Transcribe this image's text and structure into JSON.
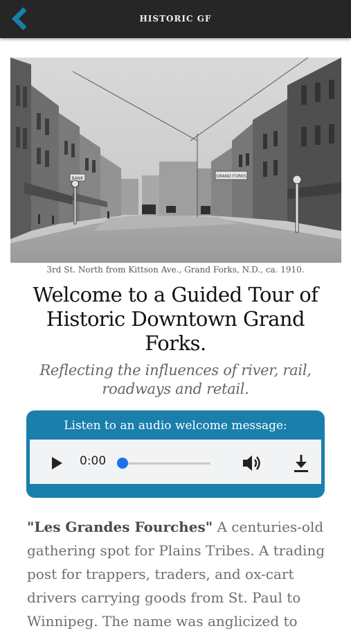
{
  "topbar": {
    "title": "HISTORIC GF",
    "back_icon": "back-chevron-icon",
    "accent": "#1a7fab"
  },
  "photo": {
    "sign_left": "BANK",
    "sign_right": "GRAND FORKS"
  },
  "caption": "3rd St. North from Kittson Ave., Grand Forks, N.D., ca. 1910.",
  "headline": "Welcome to a Guided Tour of Historic Downtown Grand Forks.",
  "subhead": "Reflecting the influences of river, rail, roadways and retail.",
  "audio": {
    "title": "Listen to an audio welcome message:",
    "time": "0:00",
    "progress": 0,
    "icons": [
      "play-icon",
      "volume-icon",
      "download-icon"
    ],
    "card_color": "#1a7fab"
  },
  "body": {
    "lead": "\"Les Grandes Fourches\"",
    "text": " A centuries-old gathering spot for Plains Tribes. A trading post for trappers, traders, and ox-cart drivers carrying goods from St. Paul to Winnipeg. The name was anglicized to"
  }
}
